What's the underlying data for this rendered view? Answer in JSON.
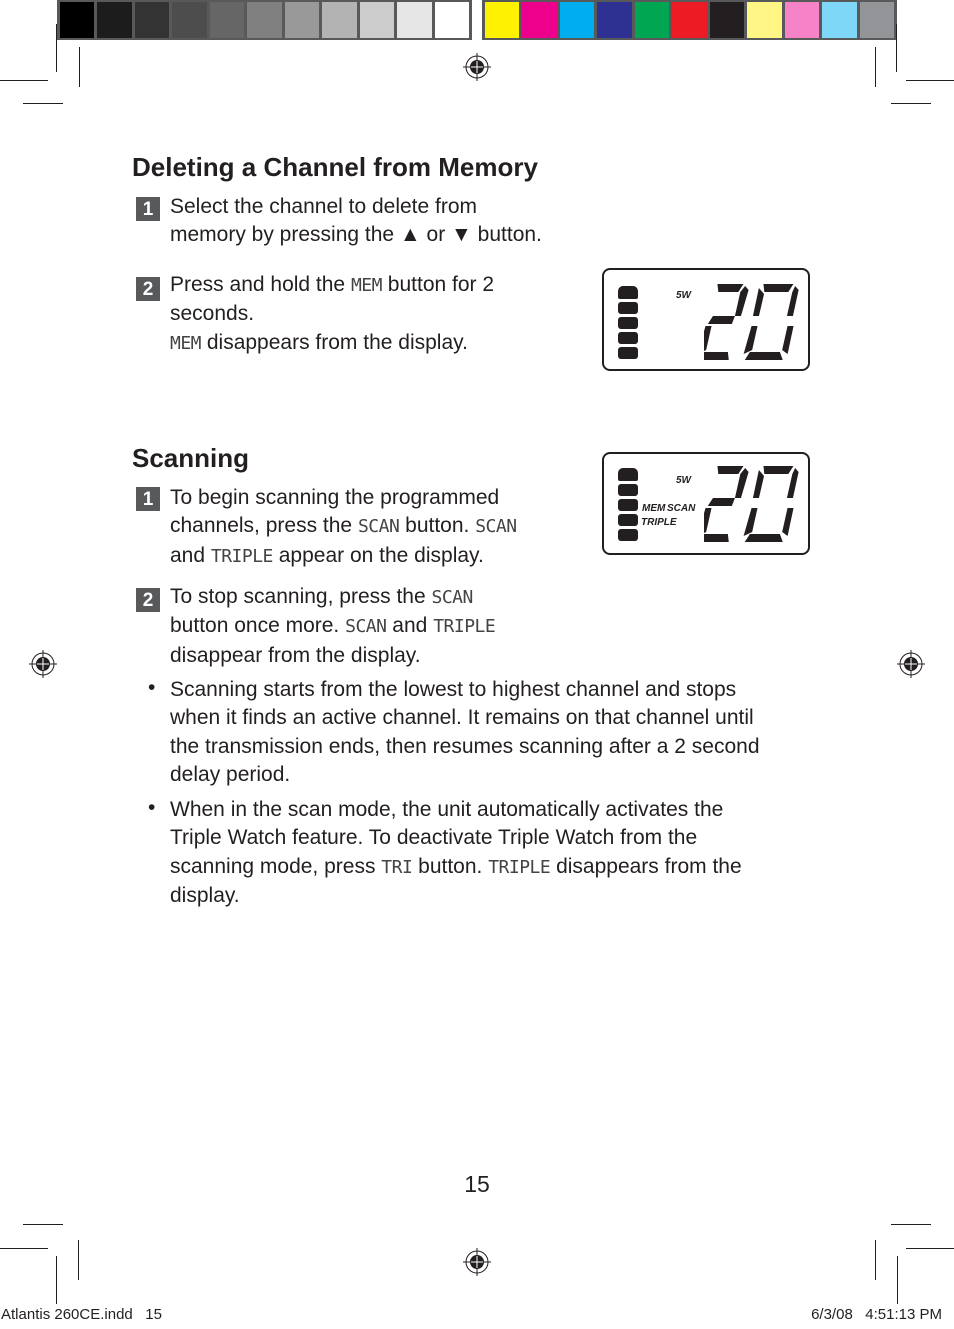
{
  "color_bars": {
    "grayscale": [
      "#000000",
      "#1c1c1c",
      "#333333",
      "#4d4d4d",
      "#666666",
      "#808080",
      "#999999",
      "#b3b3b3",
      "#cccccc",
      "#e6e6e6",
      "#ffffff"
    ],
    "process": [
      "#fff200",
      "#ec008c",
      "#00aeef",
      "#2e3192",
      "#00a651",
      "#ed1c24",
      "#231f20",
      "#fff685",
      "#f682c8",
      "#7fd7f7",
      "#939598"
    ]
  },
  "section_delete": {
    "title": "Deleting a Channel from Memory",
    "steps": [
      {
        "num": "1",
        "lines": [
          "Select the channel to delete from",
          "memory by pressing the ▲ or ▼ button."
        ]
      },
      {
        "num": "2",
        "line1_pre": "Press and hold the ",
        "line1_lcd": "MEM",
        "line1_post": " button for 2",
        "line2": "seconds.",
        "line3_lcd": "MEM",
        "line3_post": " disappears from the display."
      }
    ],
    "display": {
      "power": "5W",
      "channel": "20",
      "battery_bars": 5
    }
  },
  "section_scan": {
    "title": "Scanning",
    "step1": {
      "num": "1",
      "l1": "To begin scanning the programmed",
      "l2_pre": "channels, press the ",
      "l2_lcd1": "SCAN",
      "l2_mid": " button. ",
      "l2_lcd2": "SCAN",
      "l3_pre": "and ",
      "l3_lcd": "TRIPLE",
      "l3_post": " appear on the display."
    },
    "step2": {
      "num": "2",
      "l1_pre": "To stop scanning, press the ",
      "l1_lcd": "SCAN",
      "l2_pre": "button once more. ",
      "l2_lcd1": "SCAN",
      "l2_mid": " and ",
      "l2_lcd2": "TRIPLE",
      "l3": "disappear from the display."
    },
    "display": {
      "power": "5W",
      "mem": "MEM",
      "scan": "SCAN",
      "triple": "TRIPLE",
      "channel": "20",
      "battery_bars": 5
    },
    "bullets": {
      "b1": [
        "Scanning starts from the lowest to highest channel and stops",
        "when it finds an active channel. It remains on that channel until",
        "the transmission ends, then resumes scanning after a 2 second",
        "delay period."
      ],
      "b2_l1": "When in the scan mode, the unit automatically activates the",
      "b2_l2": "Triple Watch feature. To deactivate Triple Watch from the",
      "b2_l3_pre": "scanning mode, press ",
      "b2_l3_lcd1": "TRI",
      "b2_l3_mid": " button. ",
      "b2_l3_lcd2": "TRIPLE",
      "b2_l3_post": " disappears from the",
      "b2_l4": "display."
    }
  },
  "footer": {
    "page_number": "15",
    "slug_left": "Atlantis 260CE.indd   15",
    "slug_right": "6/3/08   4:51:13 PM"
  }
}
